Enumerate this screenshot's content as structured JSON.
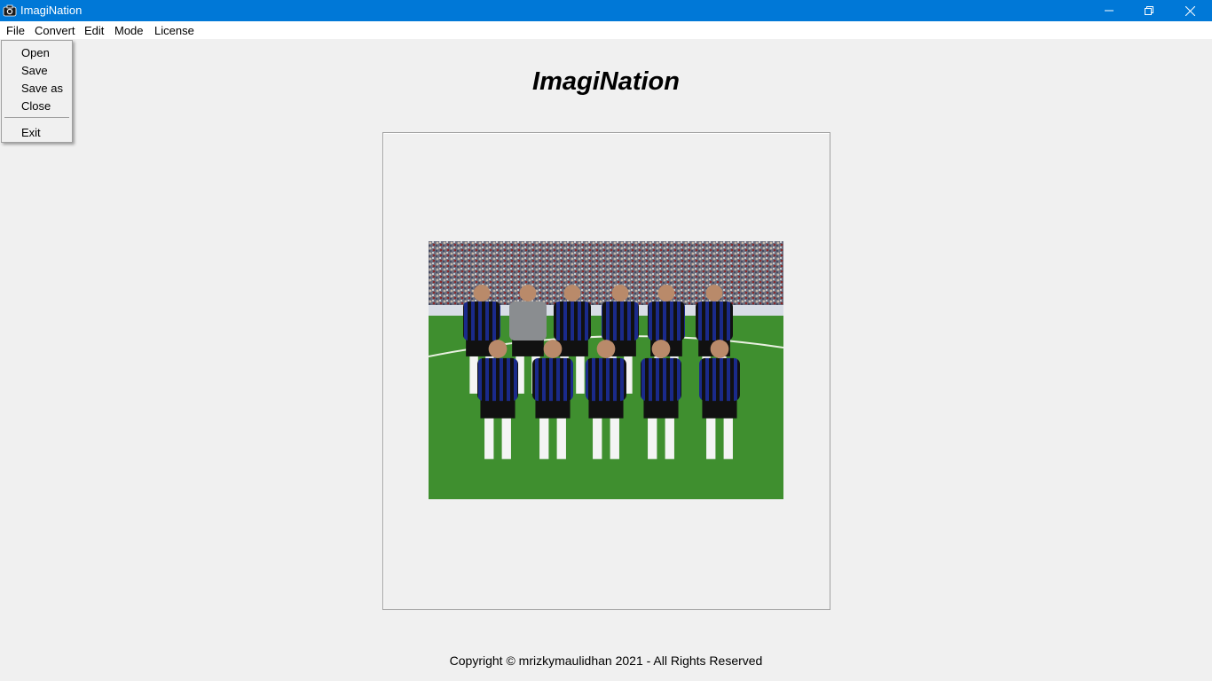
{
  "window": {
    "title": "ImagiNation",
    "controls": [
      "minimize-icon",
      "restore-icon",
      "close-icon"
    ]
  },
  "menubar": {
    "items": [
      "File",
      "Convert",
      "Edit",
      "Mode",
      "License"
    ]
  },
  "file_menu": {
    "items": [
      "Open",
      "Save",
      "Save as",
      "Close"
    ],
    "exit": "Exit"
  },
  "main": {
    "heading": "ImagiNation",
    "image": "loaded-image"
  },
  "footer": {
    "copyright": "Copyright © mrizkymaulidhan 2021 - All Rights Reserved"
  },
  "colors": {
    "titlebar": "#0078d7",
    "background": "#f0f0f0",
    "pitch": "#3f8f2f",
    "jersey_blue": "#1a2a8a",
    "jersey_black": "#111111"
  }
}
